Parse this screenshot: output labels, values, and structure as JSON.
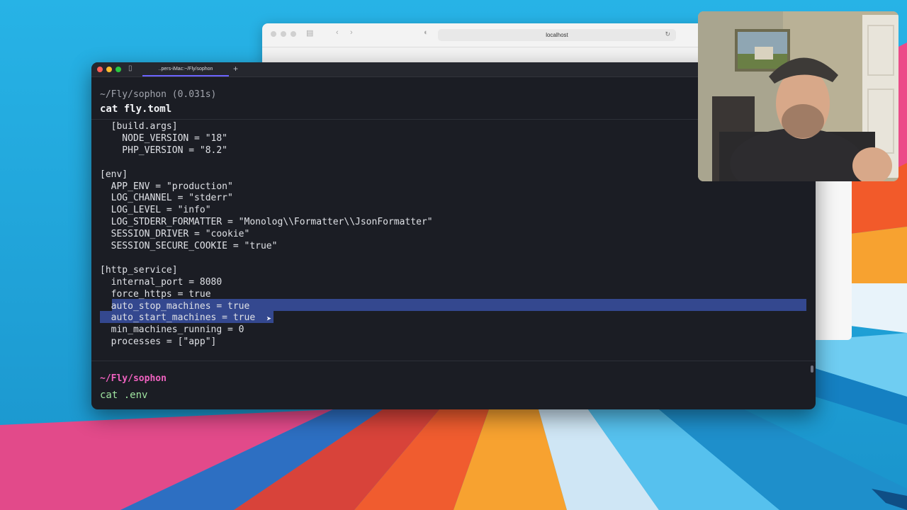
{
  "browser": {
    "url": "localhost"
  },
  "terminal": {
    "tab_title": "..pers-iMac:~/Fly/sophon",
    "new_tab_label": "+",
    "block1": {
      "path": "~/Fly/sophon",
      "duration": "(0.031s)",
      "command": "cat fly.toml"
    },
    "output_lines": [
      "  [build.args]",
      "    NODE_VERSION = \"18\"",
      "    PHP_VERSION = \"8.2\"",
      "",
      "[env]",
      "  APP_ENV = \"production\"",
      "  LOG_CHANNEL = \"stderr\"",
      "  LOG_LEVEL = \"info\"",
      "  LOG_STDERR_FORMATTER = \"Monolog\\\\Formatter\\\\JsonFormatter\"",
      "  SESSION_DRIVER = \"cookie\"",
      "  SESSION_SECURE_COOKIE = \"true\"",
      "",
      "[http_service]",
      "  internal_port = 8080",
      "  force_https = true",
      "  auto_stop_machines = true",
      "  auto_start_machines = true",
      "  min_machines_running = 0",
      "  processes = [\"app\"]"
    ],
    "block2": {
      "path": "~/Fly/sophon",
      "command": "cat .env"
    }
  },
  "colors": {
    "wallpaper_blue": "#1d9fd6",
    "terminal_bg": "#1b1d24",
    "selection": "#34488f",
    "prompt_pink": "#f062c0"
  }
}
